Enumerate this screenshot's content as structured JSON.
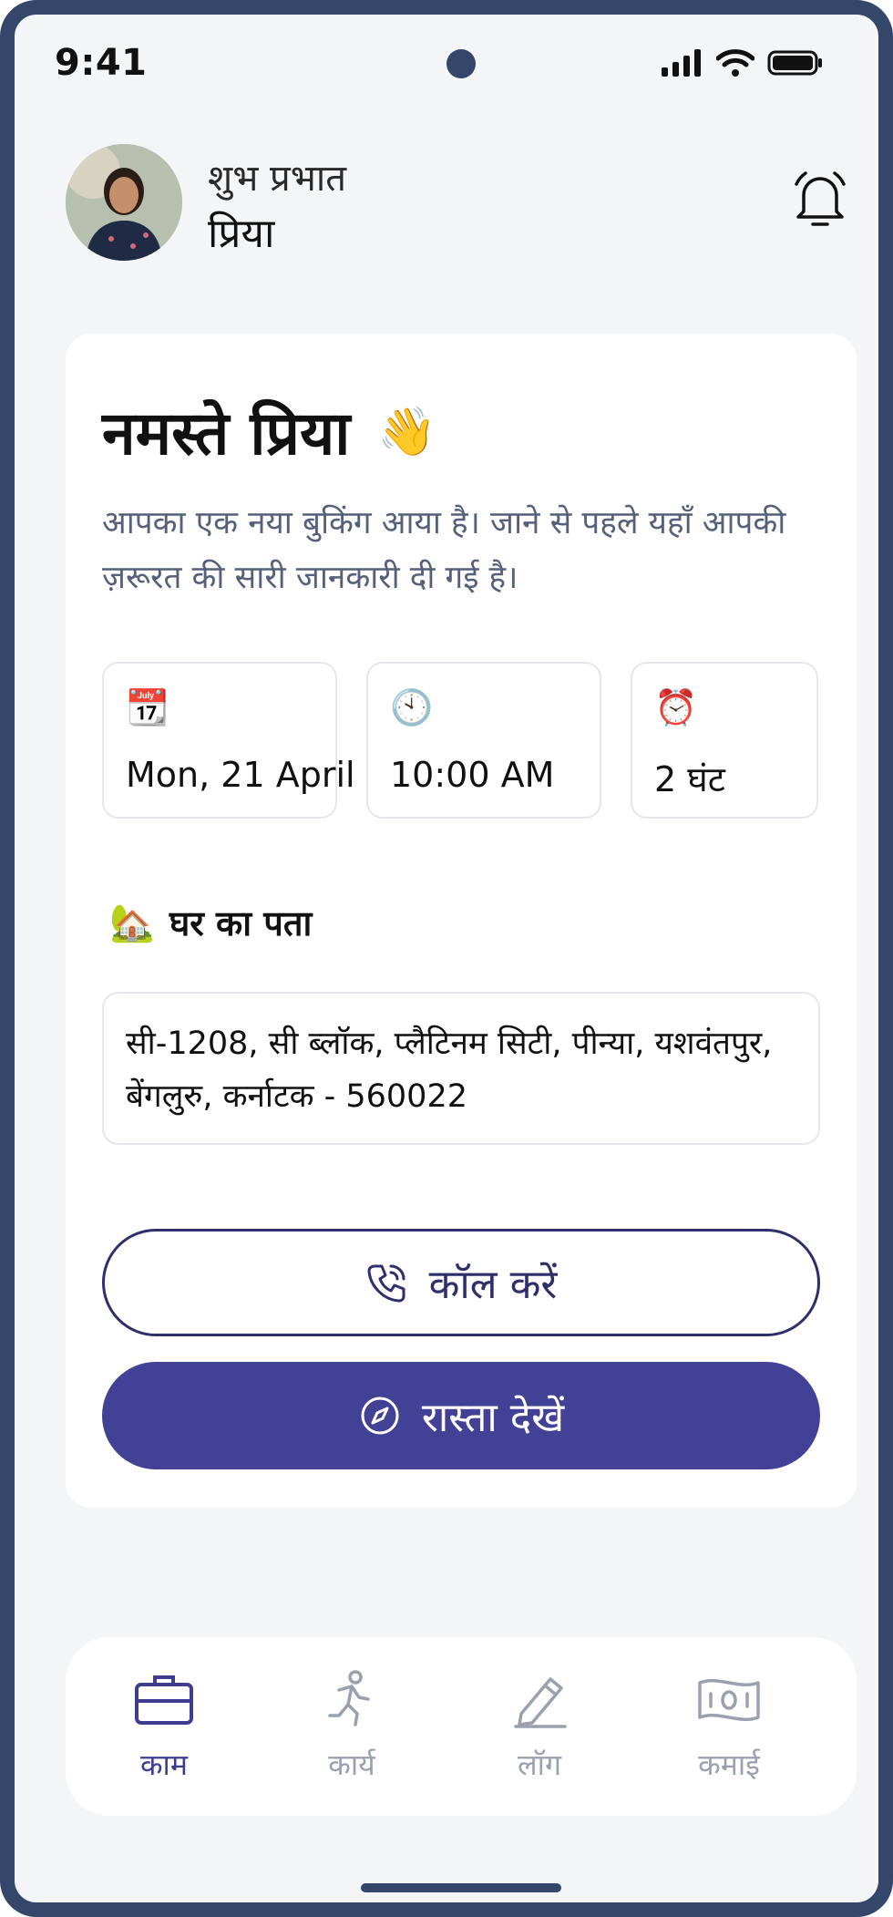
{
  "status_bar": {
    "time": "9:41"
  },
  "header": {
    "greeting": "शुभ प्रभात",
    "name": "प्रिया"
  },
  "card": {
    "title": "नमस्ते प्रिया",
    "wave_emoji": "👋",
    "intro": "आपका एक नया बुकिंग आया है। जाने से पहले यहाँ आपकी ज़रूरत की सारी जानकारी दी गई है।",
    "date_emoji": "📆",
    "date": "Mon, 21 April",
    "time_emoji": "🕙",
    "time": "10:00 AM",
    "duration_emoji": "⏰",
    "duration": "2 घंट",
    "address_emoji": "🏡",
    "address_heading": "घर का पता",
    "address": "सी-1208, सी ब्लॉक, प्लैटिनम सिटी, पीन्या, यशवंतपुर, बेंगलुरु, कर्नाटक - 560022",
    "call_button": "कॉल करें",
    "route_button": "रास्ता देखें"
  },
  "nav": {
    "items": [
      {
        "label": "काम",
        "icon": "briefcase-icon",
        "active": true
      },
      {
        "label": "कार्य",
        "icon": "running-person-icon",
        "active": false
      },
      {
        "label": "लॉग",
        "icon": "pencil-icon",
        "active": false
      },
      {
        "label": "कमाई",
        "icon": "banknote-icon",
        "active": false
      }
    ]
  },
  "colors": {
    "frame": "#34466a",
    "primary": "#434196",
    "call_outline": "#2e2f6b",
    "muted_text": "#56607a",
    "nav_inactive": "#9aa0ad"
  }
}
